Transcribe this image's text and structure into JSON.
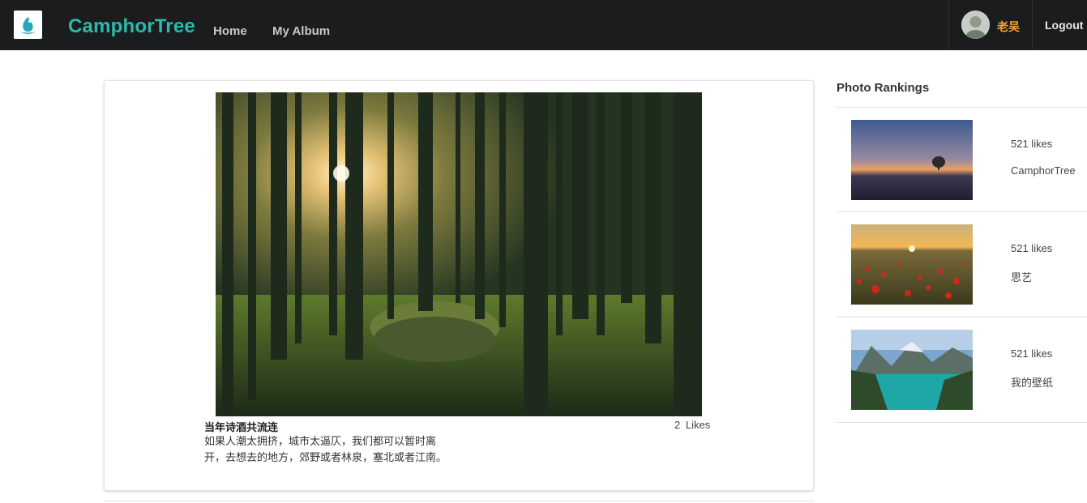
{
  "navbar": {
    "brand": "CamphorTree",
    "links": [
      {
        "label": "Home"
      },
      {
        "label": "My Album"
      }
    ],
    "user_name": "老吴",
    "logout_label": "Logout"
  },
  "post": {
    "title": "当年诗酒共流连",
    "likes": "2 Likes",
    "description": "如果人潮太拥挤，城市太逼仄，我们都可以暂时离开，去想去的地方，郊野或者林泉，塞北或者江南。"
  },
  "rankings": {
    "title": "Photo Rankings",
    "items": [
      {
        "likes": "521 likes",
        "author": "CamphorTree"
      },
      {
        "likes": "521 likes",
        "author": "思艺"
      },
      {
        "likes": "521 likes",
        "author": "我的壁纸"
      }
    ]
  },
  "colors": {
    "navbar_bg": "#1b1c1d",
    "brand": "#2bbbad",
    "user_name": "#f2a33a"
  },
  "icons": {
    "logo": "camphor-leaf-logo",
    "avatar": "user-avatar"
  }
}
